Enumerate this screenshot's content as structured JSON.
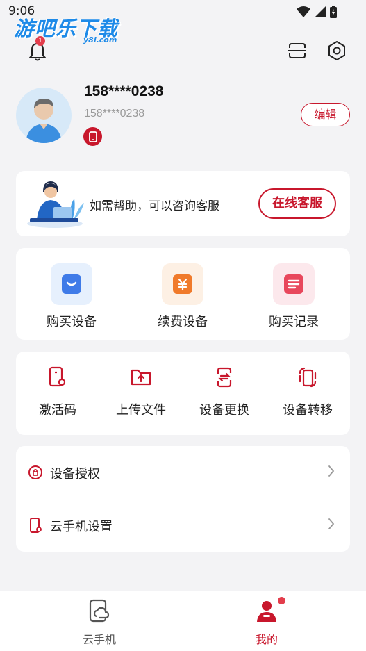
{
  "status_bar": {
    "time": "9:06"
  },
  "watermark": {
    "main": "游吧乐下载",
    "sub": "y8l.com"
  },
  "header": {
    "notification_count": "1"
  },
  "profile": {
    "phone": "158****0238",
    "phone_sub": "158****0238",
    "edit_label": "编辑"
  },
  "help": {
    "text": "如需帮助，可以咨询客服",
    "button": "在线客服"
  },
  "purchase_grid": [
    {
      "label": "购买设备",
      "icon": "shopping-bag-icon",
      "color": "#3f7be8",
      "bg": "#e6f0fd"
    },
    {
      "label": "续费设备",
      "icon": "yen-icon",
      "color": "#f07a2a",
      "bg": "#fdf0e4"
    },
    {
      "label": "购买记录",
      "icon": "list-icon",
      "color": "#e8475c",
      "bg": "#fce8ec"
    }
  ],
  "tools": [
    {
      "label": "激活码",
      "icon": "activation-code-icon"
    },
    {
      "label": "上传文件",
      "icon": "upload-folder-icon"
    },
    {
      "label": "设备更换",
      "icon": "device-swap-icon"
    },
    {
      "label": "设备转移",
      "icon": "device-transfer-icon"
    }
  ],
  "list": [
    {
      "label": "设备授权",
      "icon": "authorization-icon"
    },
    {
      "label": "云手机设置",
      "icon": "cloud-phone-settings-icon"
    }
  ],
  "bottom_nav": [
    {
      "label": "云手机",
      "icon": "cloud-phone-icon",
      "active": false
    },
    {
      "label": "我的",
      "icon": "profile-icon",
      "active": true
    }
  ],
  "colors": {
    "accent": "#c8172c",
    "background": "#f3f3f5",
    "inactive": "#555555"
  }
}
